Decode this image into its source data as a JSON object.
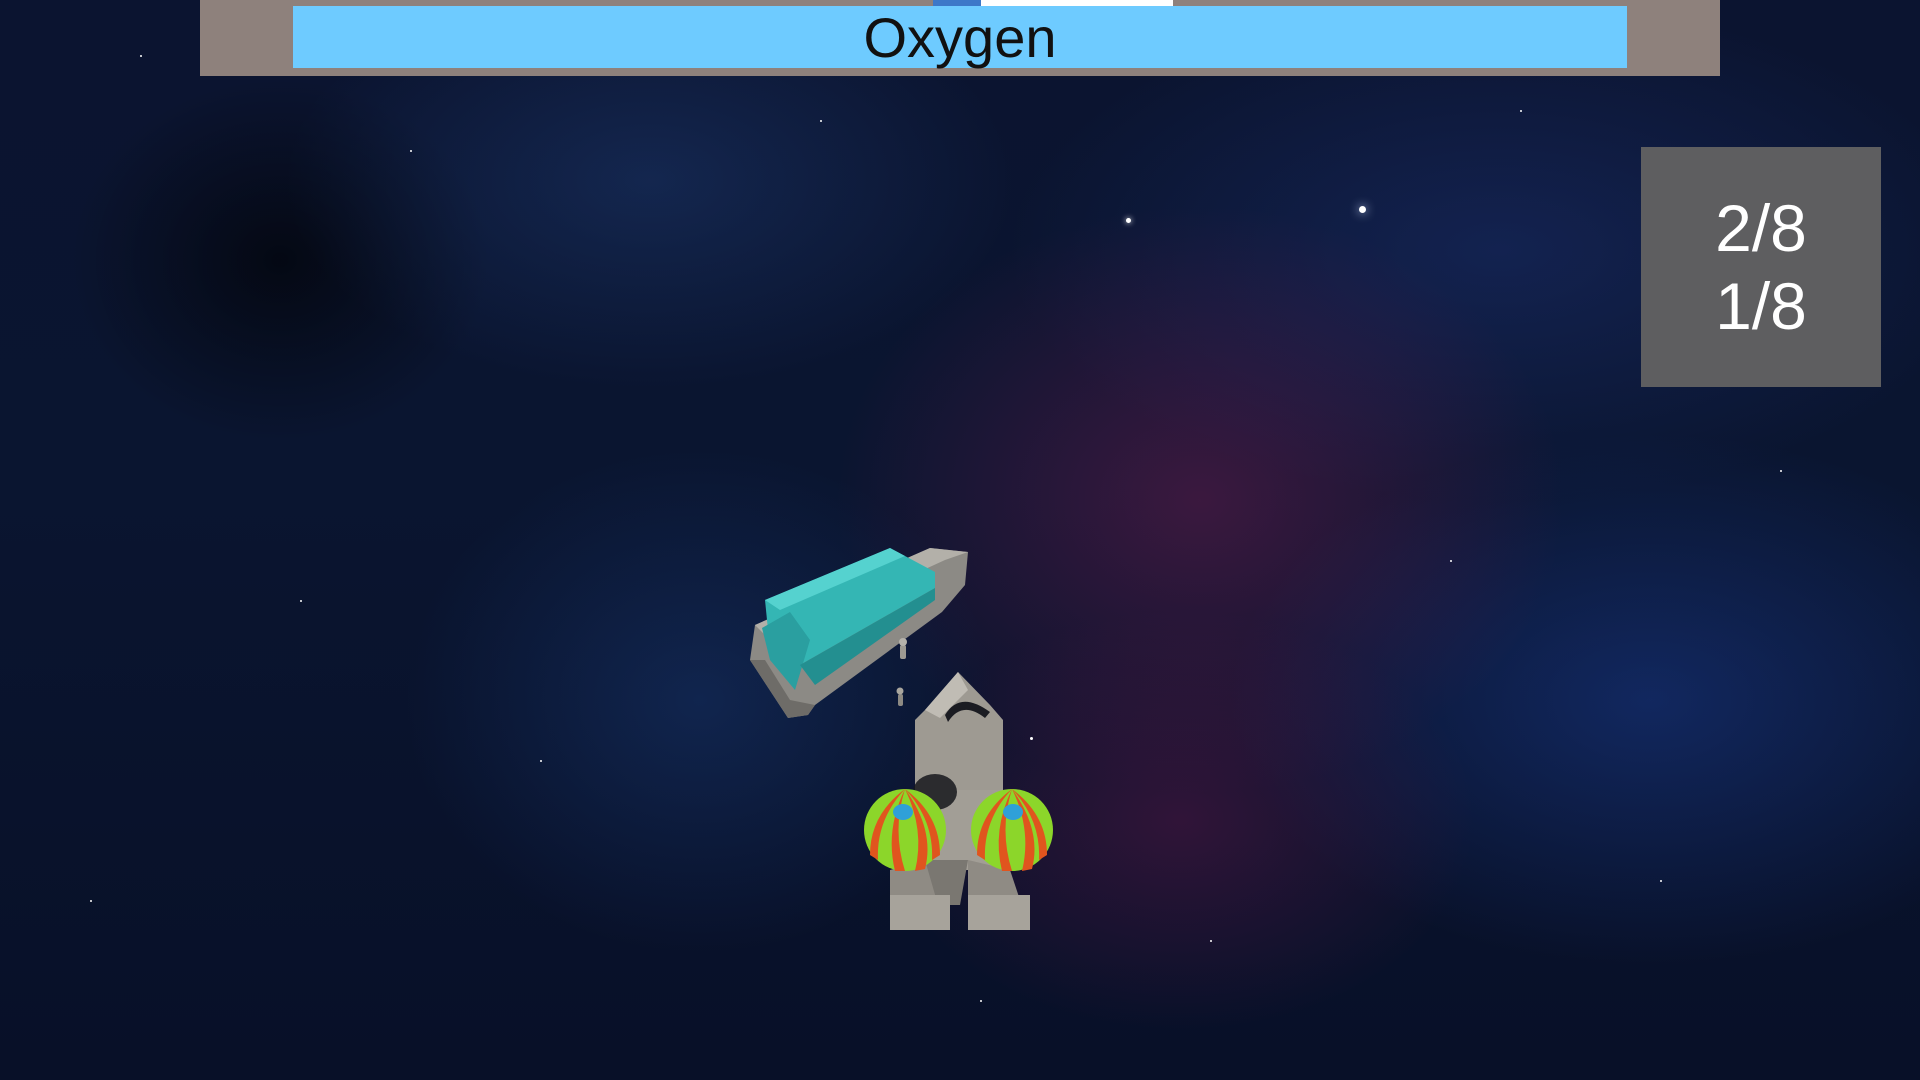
{
  "hud": {
    "oxygen": {
      "label": "Oxygen",
      "level": 1.0,
      "bar_color": "#6ecbff",
      "frame_color": "#8e817c"
    },
    "counters": {
      "line1": "2/8",
      "line2": "1/8",
      "panel_color": "#5e5e60"
    }
  },
  "scene": {
    "background": "space-nebula",
    "objects": [
      {
        "name": "cargo-ship",
        "icon": "teal-ship-icon",
        "color": "#3ab8b8"
      },
      {
        "name": "rocket",
        "icon": "rocket-icon",
        "color": "#a8a39c"
      },
      {
        "name": "astronaut",
        "icon": "astronaut-icon"
      },
      {
        "name": "balloon",
        "icon": "striped-balloon-icon",
        "colors": [
          "#8cd62a",
          "#e0551e",
          "#2fa0d8"
        ]
      }
    ]
  }
}
